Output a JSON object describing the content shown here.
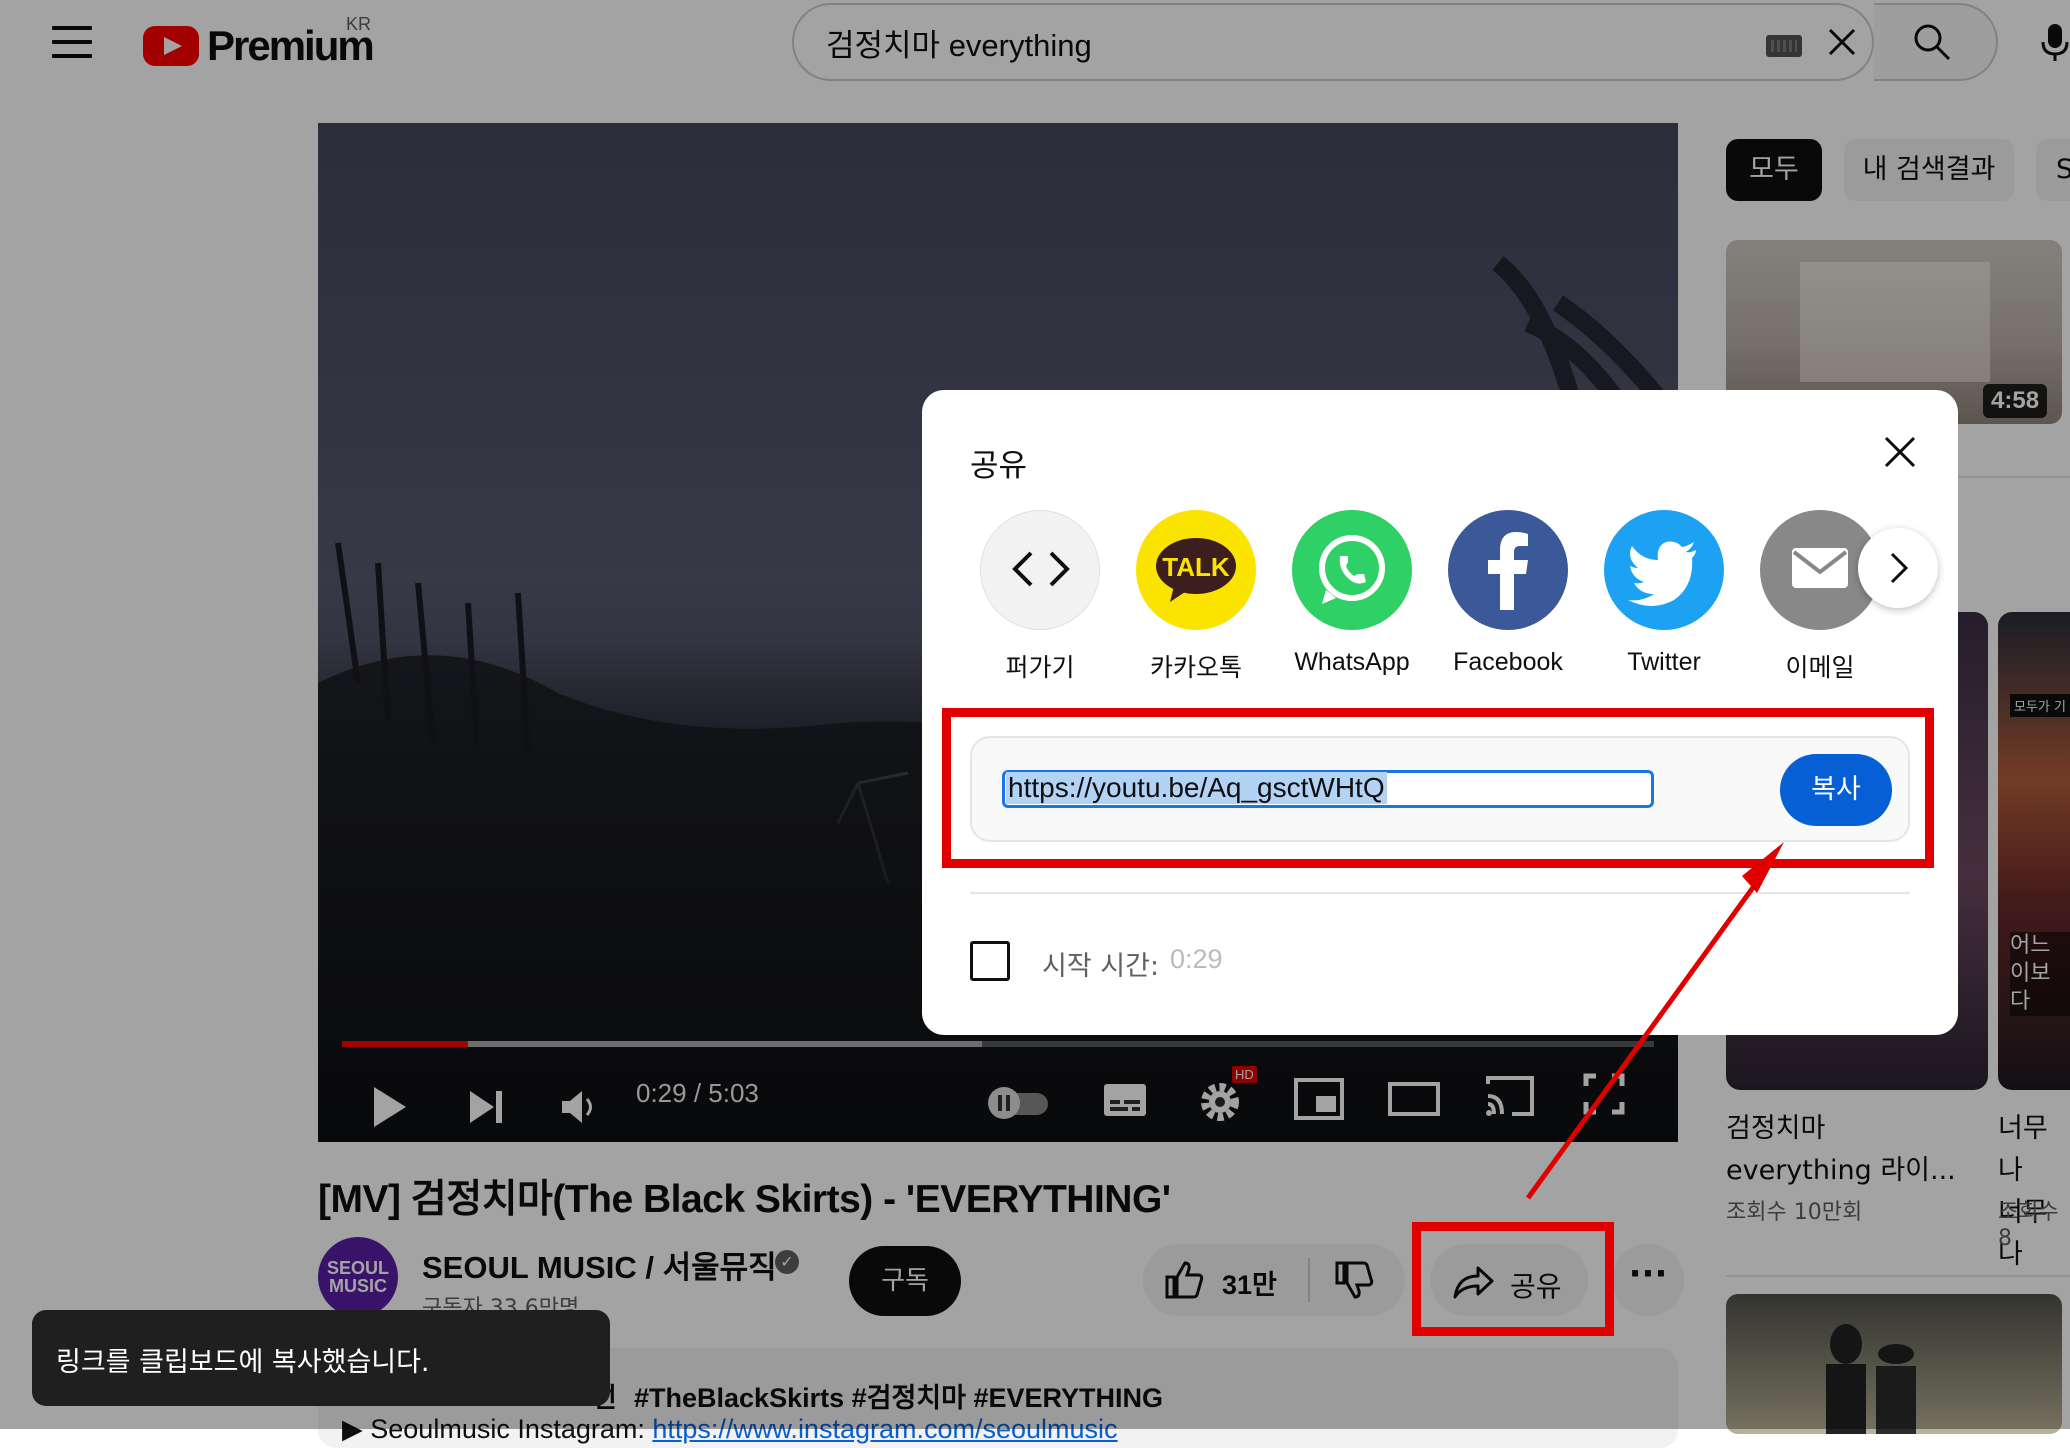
{
  "header": {
    "logo_text": "Premium",
    "logo_region": "KR",
    "search_query": "검정치마 everything"
  },
  "player": {
    "current_time": "0:29 / 5:03",
    "progress_fraction": 0.096,
    "buffer_fraction": 0.488,
    "hd_badge": "HD"
  },
  "video": {
    "title": "[MV] 검정치마(The Black Skirts) - 'EVERYTHING'",
    "channel_name": "SEOUL MUSIC / 서울뮤직",
    "avatar_text": "SEOUL MUSIC",
    "subscribers": "구독자 33.6만명",
    "subscribe_label": "구독",
    "like_count": "31만",
    "share_label": "공유",
    "hashtags": "#TheBlackSkirts #검정치마 #EVERYTHING",
    "hashtag_prefix": "선",
    "instagram_prefix": "▶ Seoulmusic Instagram: ",
    "instagram_link": "https://www.instagram.com/seoulmusic"
  },
  "sidebar": {
    "chips": [
      "모두",
      "내 검색결과",
      "S"
    ],
    "first_duration": "4:58",
    "shorts": [
      {
        "title_line1": "검정치마",
        "title_line2": "everything 라이...",
        "views": "조회수 10만회"
      },
      {
        "title_line1": "너무나",
        "title_line2": "너무나",
        "views": "조회수 8",
        "badge": "모두가 기",
        "caption_line1": "어느",
        "caption_line2": "이보다"
      }
    ]
  },
  "share_dialog": {
    "title": "공유",
    "targets": [
      {
        "label": "퍼가기",
        "icon": "embed-icon"
      },
      {
        "label": "카카오톡",
        "icon": "kakaotalk-icon",
        "badge": "TALK"
      },
      {
        "label": "WhatsApp",
        "icon": "whatsapp-icon"
      },
      {
        "label": "Facebook",
        "icon": "facebook-icon"
      },
      {
        "label": "Twitter",
        "icon": "twitter-icon"
      },
      {
        "label": "이메일",
        "icon": "email-icon"
      }
    ],
    "url": "https://youtu.be/Aq_gsctWHtQ",
    "copy_label": "복사",
    "start_time_label": "시작 시간:",
    "start_time_value": "0:29"
  },
  "toast": {
    "message": "링크를 클립보드에 복사했습니다."
  },
  "colors": {
    "brand_red": "#ff0000",
    "annotation_red": "#e10000",
    "copy_blue": "#065fd4",
    "kakao_yellow": "#fbe300",
    "whatsapp_green": "#2fd065",
    "facebook_blue": "#3b5998",
    "twitter_blue": "#1da1f2"
  }
}
